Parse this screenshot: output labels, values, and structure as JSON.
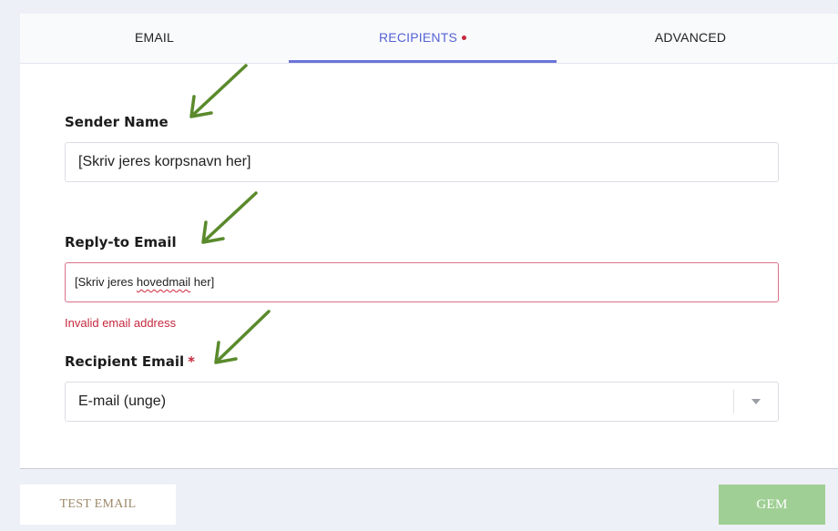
{
  "tabs": [
    {
      "label": "EMAIL"
    },
    {
      "label": "RECIPIENTS",
      "active": true,
      "has_error_dot": true
    },
    {
      "label": "ADVANCED"
    }
  ],
  "form": {
    "sender_name": {
      "label": "Sender Name",
      "value": "[Skriv jeres korpsnavn her]"
    },
    "reply_to": {
      "label": "Reply-to Email",
      "value_before": "[Skriv jeres ",
      "value_misspelled": "hovedmail",
      "value_after": " her]",
      "error": "Invalid email address"
    },
    "recipient": {
      "label": "Recipient Email",
      "required_mark": "*",
      "selected": "E-mail (unge)"
    }
  },
  "buttons": {
    "test_email": "TEST EMAIL",
    "save": "GEM"
  },
  "colors": {
    "accent": "#6a74d8",
    "error": "#c5283d",
    "annotation_arrow": "#5a8a2c",
    "save_bg": "#9fcf94"
  },
  "icons": {
    "annotation": "arrow-down-left-icon",
    "select": "chevron-down-icon",
    "error_dot": "error-dot-icon"
  }
}
